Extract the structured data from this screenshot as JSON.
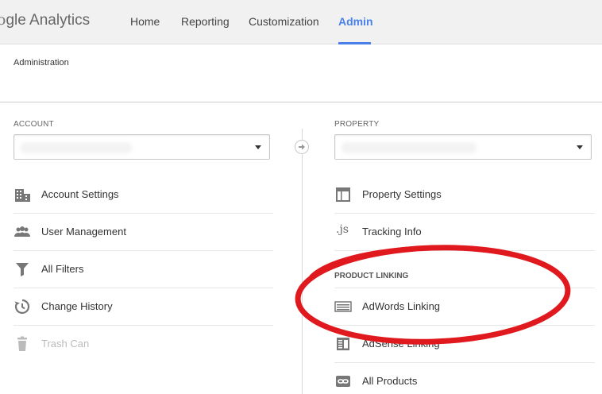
{
  "app": {
    "logo_text": "gle Analytics",
    "logo_g": "o"
  },
  "nav": {
    "items": [
      {
        "label": "Home"
      },
      {
        "label": "Reporting"
      },
      {
        "label": "Customization"
      },
      {
        "label": "Admin",
        "active": true
      }
    ]
  },
  "page": {
    "title": "Administration"
  },
  "account": {
    "header": "ACCOUNT",
    "select_value": "",
    "items": [
      {
        "label": "Account Settings",
        "icon": "building-icon"
      },
      {
        "label": "User Management",
        "icon": "users-icon"
      },
      {
        "label": "All Filters",
        "icon": "filter-icon"
      },
      {
        "label": "Change History",
        "icon": "history-icon"
      },
      {
        "label": "Trash Can",
        "icon": "trash-icon",
        "disabled": true
      }
    ]
  },
  "property": {
    "header": "PROPERTY",
    "select_value": "",
    "items": [
      {
        "label": "Property Settings",
        "icon": "window-icon"
      },
      {
        "label": "Tracking Info",
        "icon": "js-icon",
        "icon_text": ".js"
      }
    ],
    "product_linking_header": "PRODUCT LINKING",
    "linking_items": [
      {
        "label": "AdWords Linking",
        "icon": "adwords-icon"
      },
      {
        "label": "AdSense Linking",
        "icon": "adsense-icon"
      },
      {
        "label": "All Products",
        "icon": "link-icon"
      }
    ]
  },
  "colors": {
    "accent": "#4a80e8",
    "annotation": "#e0191e",
    "topbar": "#f1f1f1"
  }
}
